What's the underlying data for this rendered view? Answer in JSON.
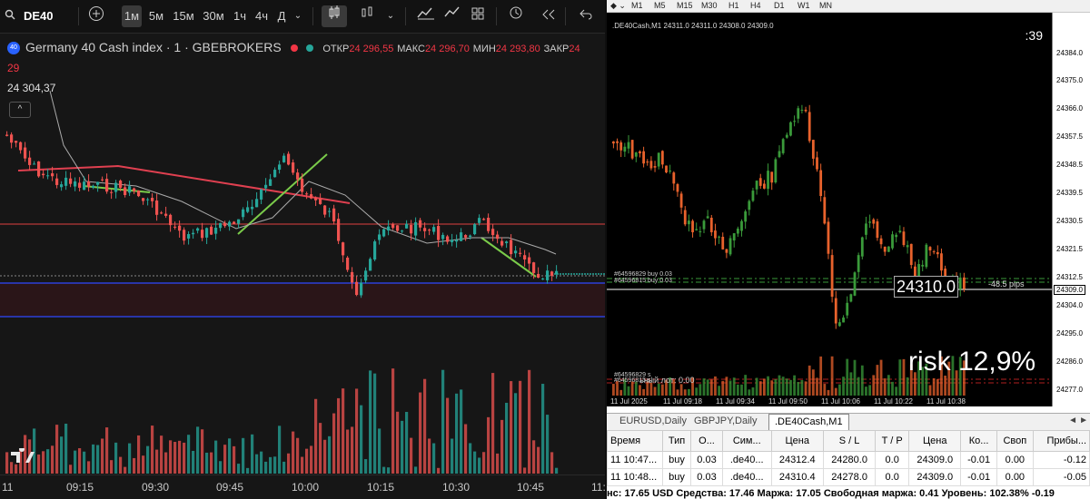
{
  "tv": {
    "symbol": "DE40",
    "timeframes": [
      "1м",
      "5м",
      "15м",
      "30м",
      "1ч",
      "4ч",
      "Д"
    ],
    "selected_tf": "1м",
    "title": "Germany 40 Cash index · 1 · GBEBROKERS",
    "ohlc": {
      "o_label": "ОТКР",
      "o": "24 296,55",
      "h_label": "МАКС",
      "h": "24 296,70",
      "l_label": "МИН",
      "l": "24 293,80",
      "c_label": "ЗАКР",
      "c": "24"
    },
    "sub_value": "29",
    "price_value": "24 304,37",
    "x_ticks": [
      "11",
      "09:15",
      "09:30",
      "09:45",
      "10:00",
      "10:15",
      "10:30",
      "10:45",
      "11:"
    ],
    "colors": {
      "up": "#26a69a",
      "down": "#ef5350",
      "accent": "#2962ff"
    }
  },
  "mt": {
    "tf_buttons": [
      "M1",
      "M5",
      "M15",
      "M30",
      "H1",
      "H4",
      "D1",
      "W1",
      "MN"
    ],
    "header": ".DE40Cash,M1  24311.0 24311.0 24308.0 24309.0",
    "timer": ":39",
    "price_ticks": [
      "24384.0",
      "24375.0",
      "24366.0",
      "24357.5",
      "24348.5",
      "24339.5",
      "24330.5",
      "24321.5",
      "24312.5",
      "24304.0",
      "24295.0",
      "24286.0",
      "24277.0"
    ],
    "current_price_tag": "24309.0",
    "big_price": "24310.0",
    "pips": "-48.5 pips",
    "risk_text": "risk 12,9%",
    "orders": [
      "#64596829 buy 0.03",
      "#64596815 buy 0.03",
      "#64596829 s",
      "#64596815 sl",
      "ьный лот: 0.00"
    ],
    "x_ticks": [
      "11 Jul 2025",
      "11 Jul 09:18",
      "11 Jul 09:34",
      "11 Jul 09:50",
      "11 Jul 10:06",
      "11 Jul 10:22",
      "11 Jul 10:38"
    ],
    "tabs": [
      "EURUSD,Daily",
      "GBPJPY,Daily",
      ".DE40Cash,M1"
    ],
    "active_tab": ".DE40Cash,M1",
    "table": {
      "headers": [
        "Время",
        "Тип",
        "О...",
        "Сим...",
        "Цена",
        "S / L",
        "T / P",
        "Цена",
        "Ко...",
        "Своп",
        "Прибы..."
      ],
      "rows": [
        [
          "11 10:47...",
          "buy",
          "0.03",
          ".de40...",
          "24312.4",
          "24280.0",
          "0.0",
          "24309.0",
          "-0.01",
          "0.00",
          "-0.12"
        ],
        [
          "11 10:48...",
          "buy",
          "0.03",
          ".de40...",
          "24310.4",
          "24278.0",
          "0.0",
          "24309.0",
          "-0.01",
          "0.00",
          "-0.05"
        ]
      ]
    },
    "status": "нс: 17.65 USD  Средства: 17.46  Маржа: 17.05  Свободная маржа: 0.41  Уровень: 102.38%  -0.19"
  }
}
